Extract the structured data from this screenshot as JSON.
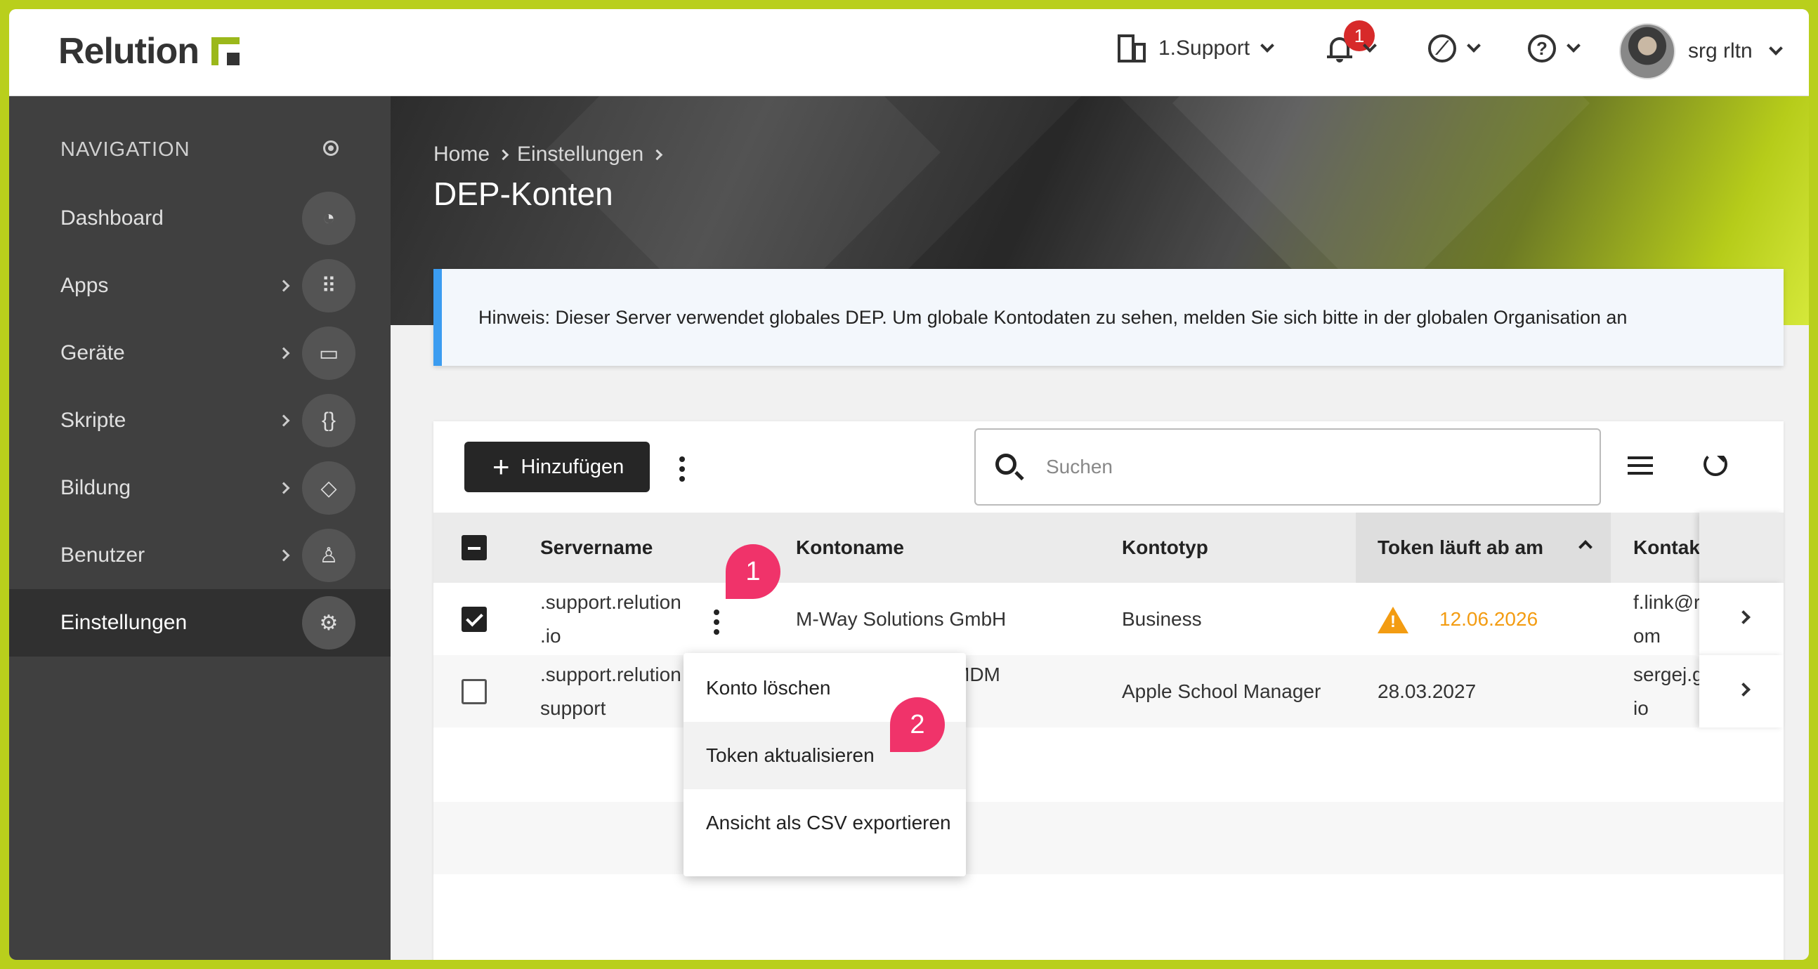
{
  "header": {
    "logo": "Relution",
    "org": "1.Support",
    "notification_count": "1",
    "user": "srg rltn",
    "icons": [
      "building-icon",
      "bell-icon",
      "compass-icon",
      "help-icon"
    ]
  },
  "sidebar": {
    "title": "NAVIGATION",
    "items": [
      {
        "label": "Dashboard",
        "icon": "speedometer-icon"
      },
      {
        "label": "Apps",
        "icon": "grid-icon"
      },
      {
        "label": "Geräte",
        "icon": "devices-icon"
      },
      {
        "label": "Skripte",
        "icon": "braces-icon"
      },
      {
        "label": "Bildung",
        "icon": "graduation-cap-icon"
      },
      {
        "label": "Benutzer",
        "icon": "user-settings-icon"
      },
      {
        "label": "Einstellungen",
        "icon": "gear-icon"
      }
    ]
  },
  "breadcrumb": [
    "Home",
    "Einstellungen"
  ],
  "page_title": "DEP-Konten",
  "notice": "Hinweis: Dieser Server verwendet globales DEP. Um globale Kontodaten zu sehen, melden Sie sich bitte in der globalen Organisation an",
  "toolbar": {
    "add_label": "Hinzufügen",
    "search_placeholder": "Suchen"
  },
  "table": {
    "columns": [
      "Servername",
      "Kontoname",
      "Kontotyp",
      "Token läuft ab am",
      "Kontak"
    ],
    "rows": [
      {
        "server_1": ".support.relution",
        "server_2": ".io",
        "account": "M-Way Solutions GmbH",
        "type": "Business",
        "expires": "12.06.2026",
        "contact_1": "f.link@r",
        "contact_2": "om",
        "checked": true,
        "warning": true
      },
      {
        "server_1": ".support.relution",
        "server_2": "support",
        "account": "MDM",
        "type": "Apple School Manager",
        "expires": "28.03.2027",
        "contact_1": "sergej.g",
        "contact_2": "io",
        "checked": false,
        "warning": false
      }
    ]
  },
  "context_menu": [
    "Konto löschen",
    "Token aktualisieren",
    "Ansicht als CSV exportieren"
  ],
  "callouts": [
    "1",
    "2"
  ],
  "colors": {
    "accent": "#b9cf1c",
    "warning": "#f39c12",
    "callout": "#f0336a",
    "notice_border": "#3b9cf0"
  }
}
